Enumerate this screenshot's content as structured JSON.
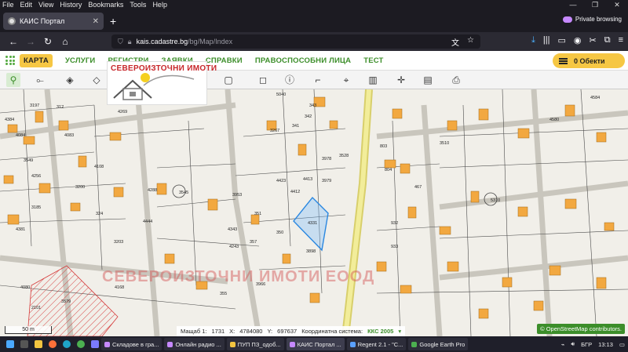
{
  "menu": [
    "File",
    "Edit",
    "View",
    "History",
    "Bookmarks",
    "Tools",
    "Help"
  ],
  "window_controls": [
    "—",
    "❐",
    "✕"
  ],
  "tab": {
    "title": "КАИС Портал",
    "close": "✕"
  },
  "newtab": "+",
  "private": "Private browsing",
  "url": {
    "host": "kais.cadastre.bg",
    "path": "/bg/Map/Index"
  },
  "site_nav": {
    "items": [
      "КАРТА",
      "УСЛУГИ",
      "РЕГИСТРИ",
      "ЗАЯВКИ",
      "СПРАВКИ",
      "ПРАВОСПОСОБНИ ЛИЦА",
      "ТЕСТ"
    ],
    "objects_label": "0 Обекти"
  },
  "logo_text": "СЕВЕРОИЗТОЧНИ ИМОТИ",
  "watermark": "СЕВЕРОИЗТОЧНИ ИМОТИ ЕООД",
  "map": {
    "scale_label": "50 m",
    "attribution": "© OpenStreetMap contributors.",
    "coords": {
      "scale_label": "Мащаб 1:",
      "scale_value": "1731",
      "x_label": "X:",
      "x_value": "4784080",
      "y_label": "Y:",
      "y_value": "697637",
      "system_label": "Координатна система:",
      "system_value": "ККС 2005"
    },
    "parcels": [
      "3197",
      "312",
      "4269",
      "4108",
      "3200",
      "4288",
      "4343",
      "4423",
      "4413",
      "4412",
      "4331",
      "3953",
      "351",
      "350",
      "3898",
      "4243",
      "357",
      "3966",
      "4168",
      "4080",
      "3579",
      "3549",
      "3185",
      "4256",
      "324",
      "343",
      "3978",
      "3979",
      "3528",
      "3267",
      "342",
      "341",
      "3545",
      "5040",
      "803",
      "804",
      "932",
      "933",
      "467",
      "3510",
      "4584",
      "4580",
      "5310",
      "4084",
      "4083",
      "4381",
      "3203",
      "4444",
      "4384",
      "355",
      "2101"
    ]
  },
  "taskbar": {
    "tasks": [
      "Складове в гра...",
      "Онлайн радио ...",
      "ПУП ПЗ_одоб...",
      "КАИС Портал ...",
      "Regent 2.1 - \"C...",
      "Google Earth Pro"
    ],
    "lang": "БГР",
    "time": "13:13"
  }
}
